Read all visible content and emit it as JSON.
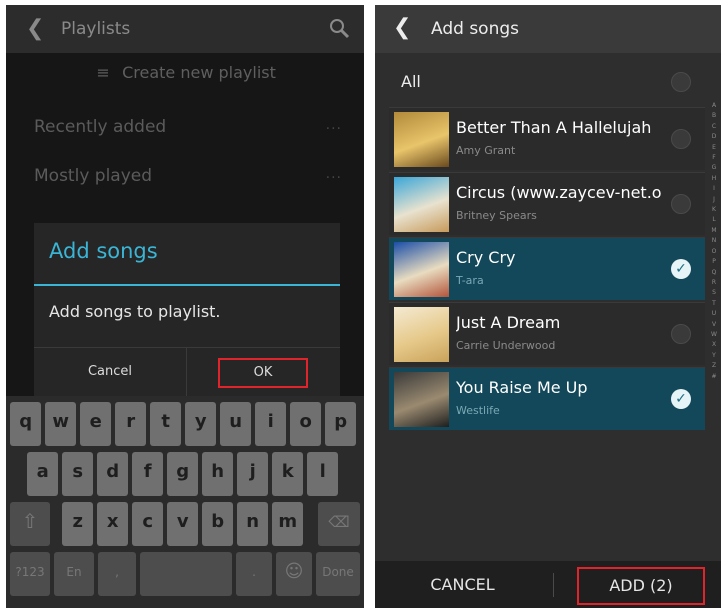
{
  "left": {
    "header": {
      "title": "Playlists",
      "back_icon": "back-chevron-icon",
      "search_icon": "search-icon"
    },
    "create_label": "Create new playlist",
    "rows": [
      {
        "label": "Recently added"
      },
      {
        "label": "Mostly played"
      }
    ],
    "dialog": {
      "title": "Add songs",
      "message": "Add songs to playlist.",
      "cancel_label": "Cancel",
      "ok_label": "OK"
    },
    "keyboard": {
      "row1": [
        "q",
        "w",
        "e",
        "r",
        "t",
        "y",
        "u",
        "i",
        "o",
        "p"
      ],
      "row2": [
        "a",
        "s",
        "d",
        "f",
        "g",
        "h",
        "j",
        "k",
        "l"
      ],
      "row3": [
        "z",
        "x",
        "c",
        "v",
        "b",
        "n",
        "m"
      ],
      "lang_label": "En",
      "comma_label": ",",
      "period_label": ".",
      "done_label": "Done"
    }
  },
  "right": {
    "header": {
      "title": "Add songs",
      "back_icon": "back-chevron-icon"
    },
    "all_label": "All",
    "songs": [
      {
        "title": "Better Than A Hallelujah",
        "artist": "Amy Grant",
        "selected": false,
        "art": [
          "#b28a3a",
          "#e8c46a",
          "#6a4a1e"
        ]
      },
      {
        "title": "Circus (www.zaycev-net.o",
        "artist": "Britney Spears",
        "selected": false,
        "art": [
          "#3aa6d8",
          "#e8e2cf",
          "#c79a5a"
        ]
      },
      {
        "title": "Cry Cry",
        "artist": "T-ara",
        "selected": true,
        "art": [
          "#1a4ea8",
          "#e8dcc0",
          "#b2543a"
        ]
      },
      {
        "title": "Just A Dream",
        "artist": "Carrie Underwood",
        "selected": false,
        "art": [
          "#f4ead2",
          "#e6c98a",
          "#c9a25a"
        ]
      },
      {
        "title": "You Raise Me Up",
        "artist": "Westlife",
        "selected": true,
        "art": [
          "#3a3a3a",
          "#9a8a70",
          "#1e1e1e"
        ]
      }
    ],
    "cancel_label": "CANCEL",
    "add_label": "ADD (2)",
    "accent": "#3ab5d6",
    "selected_bg": "#12485a",
    "highlight": "#e0242c"
  }
}
